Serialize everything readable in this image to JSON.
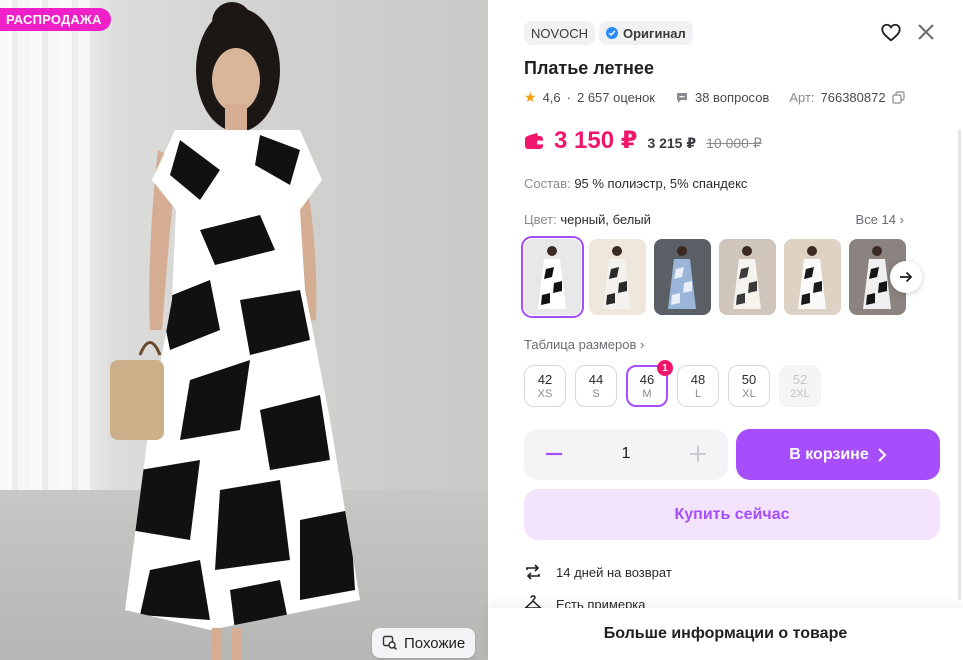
{
  "photo": {
    "sale_badge": "РАСПРОДАЖА",
    "similar_label": "Похожие"
  },
  "product": {
    "brand": "NOVOCH",
    "original_label": "Оригинал",
    "title": "Платье летнее",
    "rating": "4,6",
    "reviews": "2 657 оценок",
    "questions": "38 вопросов",
    "article_label": "Арт:",
    "article": "766380872",
    "price": "3 150 ₽",
    "price_alt": "3 215 ₽",
    "price_old": "10 000 ₽",
    "composition_label": "Состав:",
    "composition": "95 % полиэстр, 5% спандекс",
    "color_label": "Цвет:",
    "color_value": "черный, белый",
    "all_colors": "Все 14"
  },
  "thumbnails": [
    {
      "name": "black-white-floral",
      "bg": "#e8e8ea",
      "dress": "#ffffff",
      "pattern": "#111111"
    },
    {
      "name": "white-floral-sleeve",
      "bg": "#efe6dc",
      "dress": "#f4f1ee",
      "pattern": "#2a2a2a"
    },
    {
      "name": "blue-floral",
      "bg": "#5b5f66",
      "dress": "#9bb5d8",
      "pattern": "#e8eef7"
    },
    {
      "name": "white-leaf",
      "bg": "#cfc5bb",
      "dress": "#f6f3ef",
      "pattern": "#3b3b3b"
    },
    {
      "name": "white-black-print",
      "bg": "#ddd2c4",
      "dress": "#fbfaf8",
      "pattern": "#1a1a1a"
    },
    {
      "name": "black-white-print",
      "bg": "#8a8380",
      "dress": "#efefef",
      "pattern": "#151515"
    }
  ],
  "size_table_label": "Таблица размеров",
  "sizes": [
    {
      "num": "42",
      "letter": "XS",
      "state": "normal"
    },
    {
      "num": "44",
      "letter": "S",
      "state": "normal"
    },
    {
      "num": "46",
      "letter": "M",
      "state": "selected",
      "badge": "1"
    },
    {
      "num": "48",
      "letter": "L",
      "state": "normal"
    },
    {
      "num": "50",
      "letter": "XL",
      "state": "normal"
    },
    {
      "num": "52",
      "letter": "2XL",
      "state": "disabled"
    }
  ],
  "cart": {
    "quantity": "1",
    "in_cart_label": "В корзине",
    "buy_now_label": "Купить сейчас"
  },
  "features": {
    "return": "14 дней на возврат",
    "fitting": "Есть примерка"
  },
  "more_info": "Больше информации о товаре",
  "colors": {
    "accent": "#a64dfc",
    "price": "#f0166b",
    "sale": "#f020c8",
    "light_accent": "#f3e3fd"
  }
}
